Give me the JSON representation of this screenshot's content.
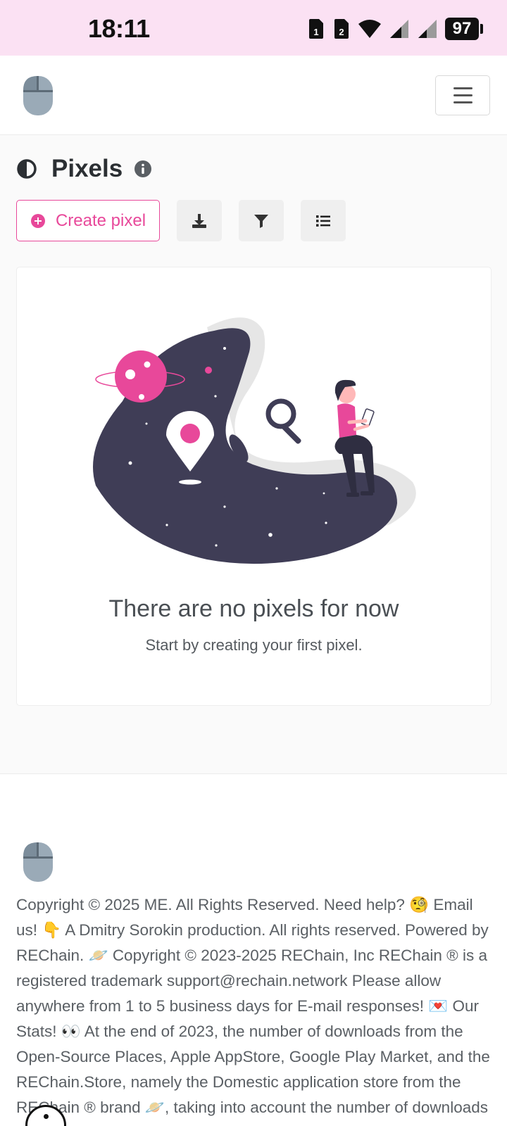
{
  "status_bar": {
    "time": "18:11",
    "battery": "97",
    "icons": [
      "sim-1-icon",
      "sim-2-icon",
      "wifi-icon",
      "signal-icon",
      "signal-icon",
      "battery-icon"
    ]
  },
  "navbar": {
    "logo_icon": "mouse-icon",
    "menu_icon": "hamburger-icon"
  },
  "page": {
    "title": "Pixels",
    "title_icon": "half-circle-icon",
    "info_icon": "info-icon"
  },
  "toolbar": {
    "create_label": "Create pixel",
    "create_icon": "plus-circle-icon",
    "buttons": [
      "download-icon",
      "filter-icon",
      "list-icon"
    ]
  },
  "empty_state": {
    "title": "There are no pixels for now",
    "subtitle": "Start by creating your first pixel."
  },
  "footer": {
    "logo_icon": "mouse-icon",
    "text": "Copyright © 2025 ME. All Rights Reserved. Need help? 🧐 Email us! 👇 A Dmitry Sorokin production. All rights reserved. Powered by REChain. 🪐 Copyright © 2023-2025 REChain, Inc REChain ® is a registered trademark support@rechain.network Please allow anywhere from 1 to 5 business days for E-mail responses! 💌 Our Stats! 👀 At the end of 2023, the number of downloads from the Open-Source Places, Apple AppStore, Google Play Market, and the REChain.Store, namely the Domestic application store from the REChain ® brand 🪐, taking into account the number of downloads of REChain..."
  },
  "colors": {
    "accent": "#e8489a",
    "status_bar_bg": "#fbe1f3",
    "illustration_dark": "#3f3d56"
  }
}
